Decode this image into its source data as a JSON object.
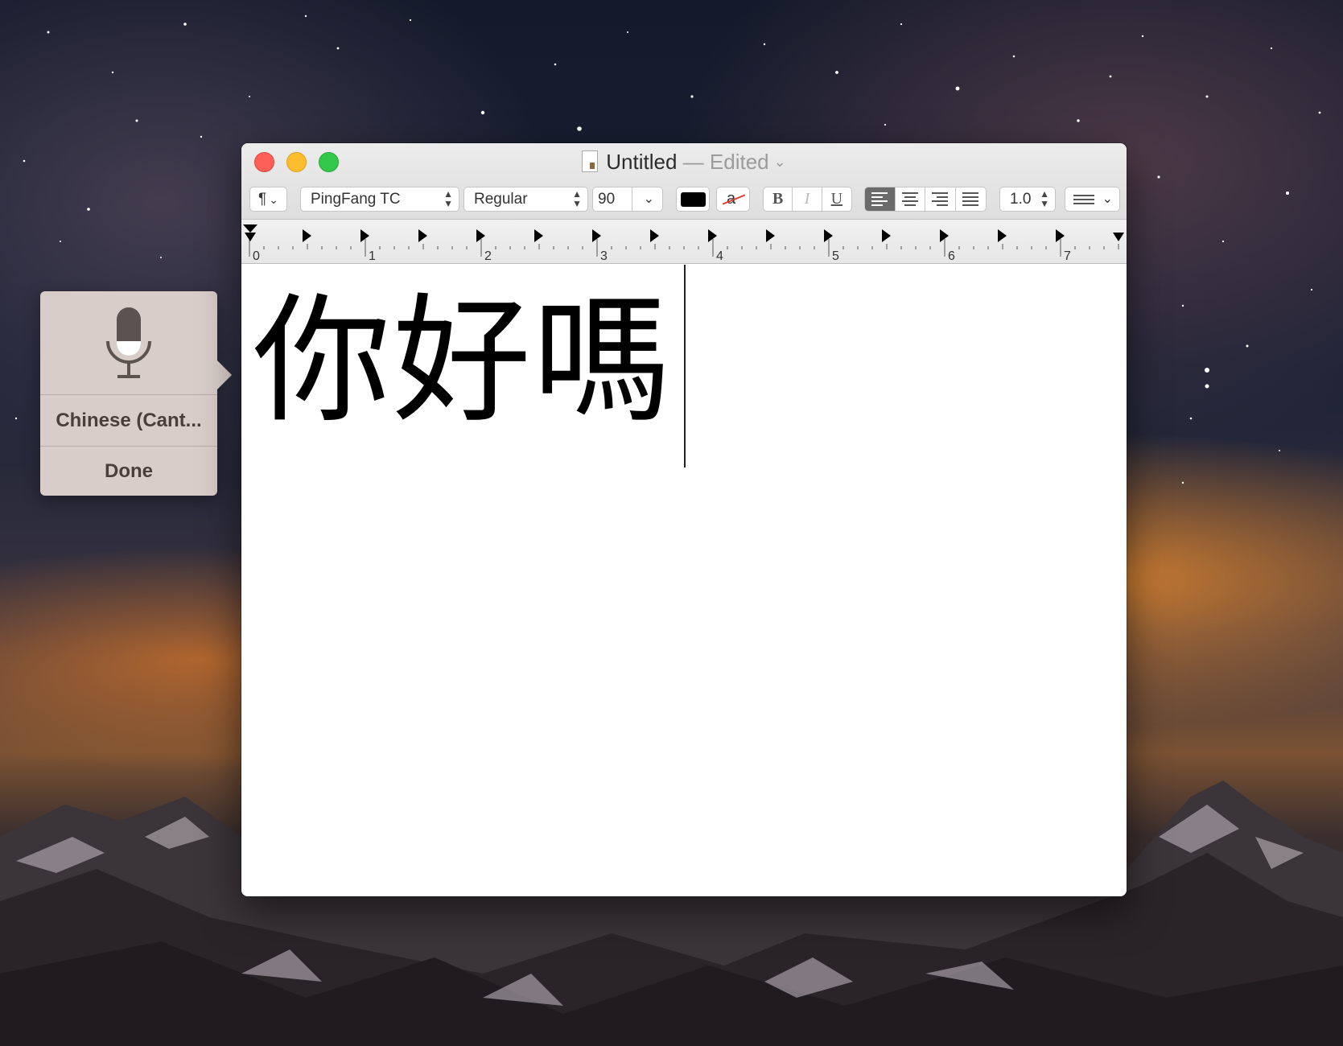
{
  "window": {
    "title": "Untitled",
    "title_separator": " — ",
    "edited_label": "Edited"
  },
  "toolbar": {
    "paragraph_label": "¶",
    "font_family": "PingFang TC",
    "font_style": "Regular",
    "font_size": "90",
    "text_color": "#000000",
    "highlight_label": "a",
    "bold_label": "B",
    "italic_label": "I",
    "underline_label": "U",
    "alignment_selected": "left",
    "line_spacing": "1.0"
  },
  "ruler": {
    "numbers": [
      "0",
      "1",
      "2",
      "3",
      "4",
      "5",
      "6",
      "7"
    ]
  },
  "document": {
    "text": "你好嗎"
  },
  "dictation": {
    "language": "Chinese (Cant...",
    "done_label": "Done"
  }
}
